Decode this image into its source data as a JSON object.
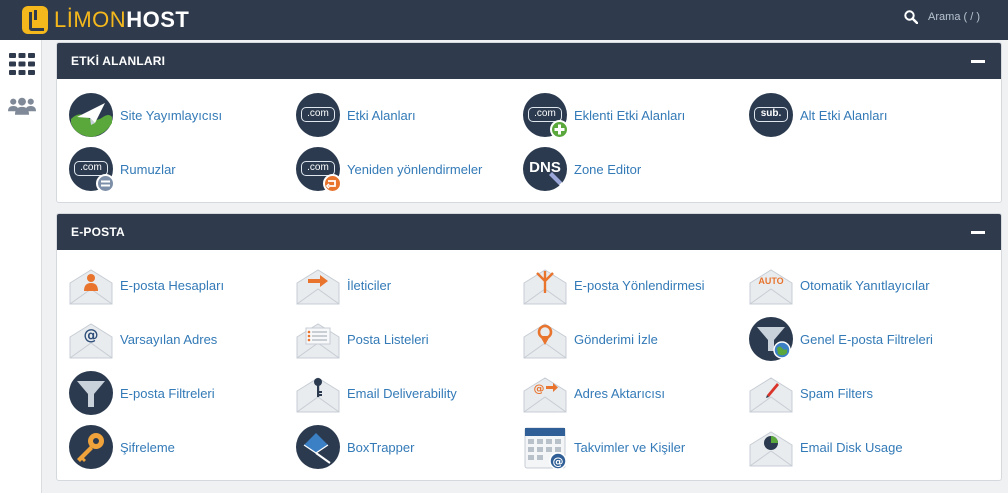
{
  "app": {
    "logo_part1": "LİMON",
    "logo_part2": "HOST"
  },
  "search": {
    "placeholder": "Arama ( / )"
  },
  "sidebar": {
    "items": [
      {
        "icon": "grid-icon"
      },
      {
        "icon": "users-icon"
      }
    ]
  },
  "colors": {
    "header": "#2f3b4c",
    "accent": "#f5b81c",
    "link": "#337ab7",
    "orange": "#e8742e"
  },
  "domains": {
    "title": "ETKİ ALANLARI",
    "items": [
      {
        "label": "Site Yayımlayıcısı",
        "icon": "site-publisher-icon"
      },
      {
        "label": "Etki Alanları",
        "icon": "domains-icon"
      },
      {
        "label": "Eklenti Etki Alanları",
        "icon": "addon-domains-icon"
      },
      {
        "label": "Alt Etki Alanları",
        "icon": "subdomains-icon"
      },
      {
        "label": "Rumuzlar",
        "icon": "aliases-icon"
      },
      {
        "label": "Yeniden yönlendirmeler",
        "icon": "redirects-icon"
      },
      {
        "label": "Zone Editor",
        "icon": "zone-editor-icon"
      }
    ],
    "dotcom_text": ".com",
    "sub_text": "sub.",
    "dns_text": "DNS"
  },
  "email": {
    "title": "E-POSTA",
    "items": [
      {
        "label": "E-posta Hesapları",
        "icon": "email-accounts-icon"
      },
      {
        "label": "İleticiler",
        "icon": "forwarders-icon"
      },
      {
        "label": "E-posta Yönlendirmesi",
        "icon": "email-routing-icon"
      },
      {
        "label": "Otomatik Yanıtlayıcılar",
        "icon": "autoresponders-icon"
      },
      {
        "label": "Varsayılan Adres",
        "icon": "default-address-icon"
      },
      {
        "label": "Posta Listeleri",
        "icon": "mailing-lists-icon"
      },
      {
        "label": "Gönderimi İzle",
        "icon": "track-delivery-icon"
      },
      {
        "label": "Genel E-posta Filtreleri",
        "icon": "global-filters-icon"
      },
      {
        "label": "E-posta Filtreleri",
        "icon": "email-filters-icon"
      },
      {
        "label": "Email Deliverability",
        "icon": "email-deliverability-icon"
      },
      {
        "label": "Adres Aktarıcısı",
        "icon": "address-importer-icon"
      },
      {
        "label": "Spam Filters",
        "icon": "spam-filters-icon"
      },
      {
        "label": "Şifreleme",
        "icon": "encryption-icon"
      },
      {
        "label": "BoxTrapper",
        "icon": "boxtrapper-icon"
      },
      {
        "label": "Takvimler ve Kişiler",
        "icon": "calendars-contacts-icon"
      },
      {
        "label": "Email Disk Usage",
        "icon": "email-disk-usage-icon"
      }
    ],
    "auto_text": "AUTO"
  }
}
